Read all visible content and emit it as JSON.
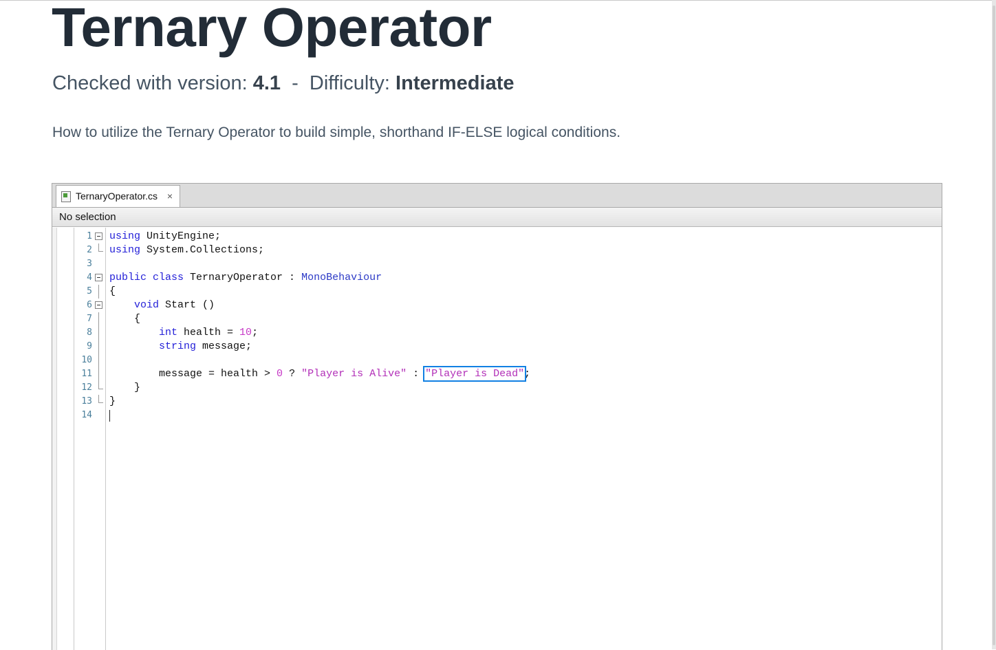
{
  "page": {
    "title": "Ternary Operator",
    "meta": {
      "version_label": "Checked with version:",
      "version_value": "4.1",
      "separator": "-",
      "difficulty_label": "Difficulty:",
      "difficulty_value": "Intermediate"
    },
    "description": "How to utilize the Ternary Operator to build simple, shorthand IF-ELSE logical conditions."
  },
  "ide": {
    "tab": {
      "label": "TernaryOperator.cs",
      "close": "×"
    },
    "selection_bar": "No selection",
    "lines": [
      {
        "n": "1"
      },
      {
        "n": "2"
      },
      {
        "n": "3"
      },
      {
        "n": "4"
      },
      {
        "n": "5"
      },
      {
        "n": "6"
      },
      {
        "n": "7"
      },
      {
        "n": "8"
      },
      {
        "n": "9"
      },
      {
        "n": "10"
      },
      {
        "n": "11"
      },
      {
        "n": "12"
      },
      {
        "n": "13"
      },
      {
        "n": "14"
      }
    ],
    "code": {
      "l1": [
        "using",
        " UnityEngine;"
      ],
      "l2": [
        "using",
        " System.Collections;"
      ],
      "l4": [
        "public class",
        " TernaryOperator : ",
        "MonoBehaviour"
      ],
      "l5": [
        "{"
      ],
      "l6": [
        "    ",
        "void",
        " Start ()"
      ],
      "l7": [
        "    {"
      ],
      "l8": [
        "        ",
        "int",
        " health = ",
        "10",
        ";"
      ],
      "l9": [
        "        ",
        "string",
        " message;"
      ],
      "l11": [
        "        message = health > ",
        "0",
        " ? ",
        "\"Player is Alive\"",
        " : ",
        "\"Player is Dead\"",
        ";"
      ],
      "l12": [
        "    }"
      ],
      "l13": [
        "}"
      ]
    }
  }
}
